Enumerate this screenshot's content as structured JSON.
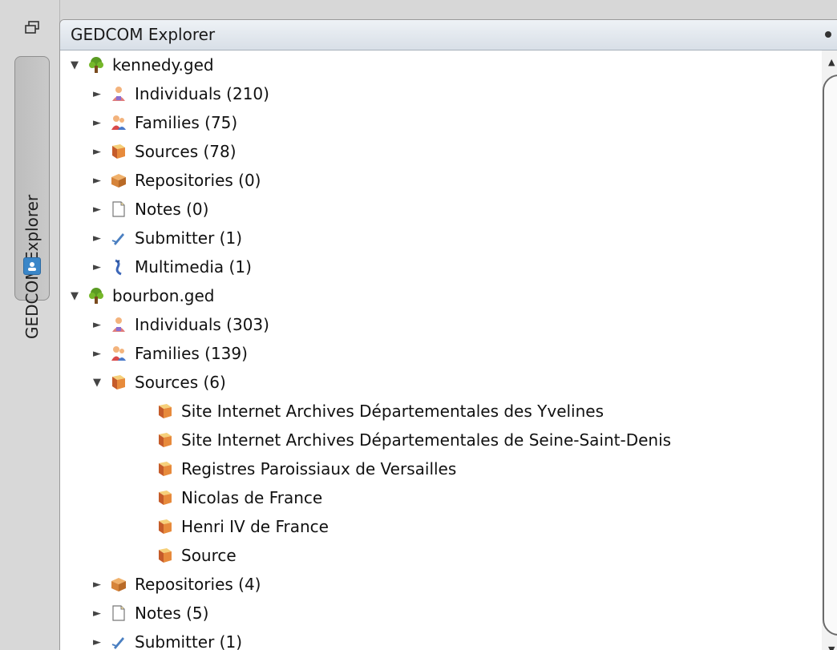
{
  "dock": {
    "vertical_tab_label": "GEDCOM Explorer",
    "restore_icon": "restore-window-icon",
    "tab_icon": "explorer-icon"
  },
  "panel": {
    "title": "GEDCOM Explorer",
    "menu_dot_icon": "panel-menu-dot-icon"
  },
  "tree": [
    {
      "label": "kennedy.ged",
      "icon": "tree-icon",
      "expanded": true,
      "level": 0,
      "arrow": "▼"
    },
    {
      "label": "Individuals (210)",
      "icon": "individual-icon",
      "expanded": false,
      "level": 1,
      "arrow": "►"
    },
    {
      "label": "Families (75)",
      "icon": "family-icon",
      "expanded": false,
      "level": 1,
      "arrow": "►"
    },
    {
      "label": "Sources (78)",
      "icon": "source-book-icon",
      "expanded": false,
      "level": 1,
      "arrow": "►"
    },
    {
      "label": "Repositories (0)",
      "icon": "repository-box-icon",
      "expanded": false,
      "level": 1,
      "arrow": "►"
    },
    {
      "label": "Notes (0)",
      "icon": "note-page-icon",
      "expanded": false,
      "level": 1,
      "arrow": "►"
    },
    {
      "label": "Submitter (1)",
      "icon": "submitter-pen-icon",
      "expanded": false,
      "level": 1,
      "arrow": "►"
    },
    {
      "label": "Multimedia (1)",
      "icon": "multimedia-clip-icon",
      "expanded": false,
      "level": 1,
      "arrow": "►"
    },
    {
      "label": "bourbon.ged",
      "icon": "tree-icon",
      "expanded": true,
      "level": 0,
      "arrow": "▼"
    },
    {
      "label": "Individuals (303)",
      "icon": "individual-icon",
      "expanded": false,
      "level": 1,
      "arrow": "►"
    },
    {
      "label": "Families (139)",
      "icon": "family-icon",
      "expanded": false,
      "level": 1,
      "arrow": "►"
    },
    {
      "label": "Sources (6)",
      "icon": "source-book-icon",
      "expanded": true,
      "level": 1,
      "arrow": "▼"
    },
    {
      "label": "Site Internet Archives Départementales des Yvelines",
      "icon": "source-book-icon",
      "level": 2,
      "arrow": ""
    },
    {
      "label": "Site Internet Archives Départementales de Seine-Saint-Denis",
      "icon": "source-book-icon",
      "level": 2,
      "arrow": ""
    },
    {
      "label": "Registres Paroissiaux de Versailles",
      "icon": "source-book-icon",
      "level": 2,
      "arrow": ""
    },
    {
      "label": "Nicolas de France",
      "icon": "source-book-icon",
      "level": 2,
      "arrow": ""
    },
    {
      "label": "Henri IV de France",
      "icon": "source-book-icon",
      "level": 2,
      "arrow": ""
    },
    {
      "label": "Source",
      "icon": "source-book-icon",
      "level": 2,
      "arrow": ""
    },
    {
      "label": "Repositories (4)",
      "icon": "repository-box-icon",
      "expanded": false,
      "level": 1,
      "arrow": "►"
    },
    {
      "label": "Notes (5)",
      "icon": "note-page-icon",
      "expanded": false,
      "level": 1,
      "arrow": "►"
    },
    {
      "label": "Submitter (1)",
      "icon": "submitter-pen-icon",
      "expanded": false,
      "level": 1,
      "arrow": "►"
    }
  ],
  "scrollbar": {
    "up_arrow": "▲",
    "down_arrow": "▼"
  }
}
